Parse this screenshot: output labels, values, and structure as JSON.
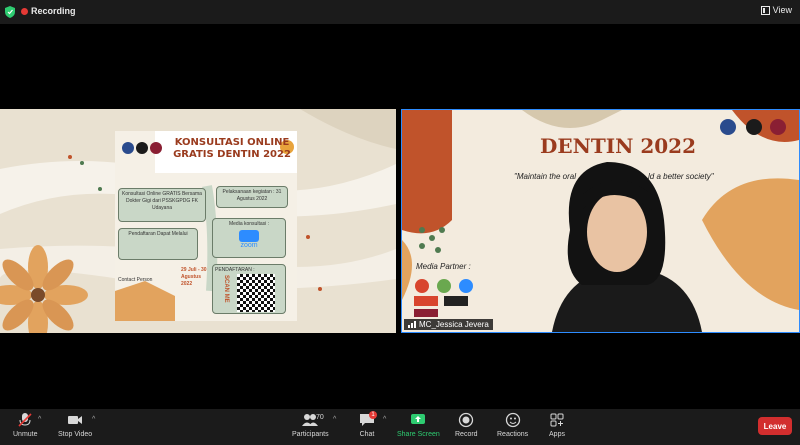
{
  "top_bar": {
    "recording_label": "Recording",
    "view_label": "View"
  },
  "share": {
    "poster_title": "KONSULTASI ONLINE GRATIS DENTIN 2022",
    "box1": "Konsultasi Online GRATIS Bersama Dokter Gigi dari PSSKGPDG FK Udayana",
    "box2": "Pelaksanaan kegiatan : 31 Agustus 2022",
    "box3": "Pendaftaran Dapat Melalui",
    "box4": "Media konsultasi :",
    "zoom_label": "zoom",
    "box5": "PENDAFTARAN :",
    "dates": "29 Juli - 30 Agustus 2022",
    "scan": "SCAN ME",
    "contact": "Contact Person"
  },
  "camera": {
    "title": "DENTIN 2022",
    "slogan": "\"Maintain the oral",
    "slogan_right": "ld a better society\"",
    "media_partner": "Media Partner :",
    "participant_name": "MC_Jessica Jevera"
  },
  "toolbar": {
    "unmute": "Unmute",
    "stop_video": "Stop Video",
    "participants": "Participants",
    "participant_count": "70",
    "chat": "Chat",
    "chat_badge": "1",
    "share_screen": "Share Screen",
    "record": "Record",
    "reactions": "Reactions",
    "apps": "Apps",
    "leave": "Leave"
  },
  "colors": {
    "share_green": "#2ecc71",
    "leave_red": "#d22e2e",
    "accent_orange": "#c0532b"
  }
}
